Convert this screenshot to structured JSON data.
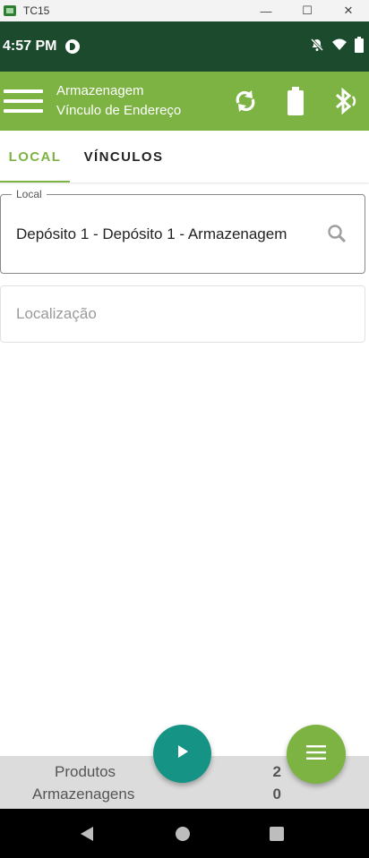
{
  "window": {
    "title": "TC15",
    "minimize_glyph": "—",
    "maximize_glyph": "☐",
    "close_glyph": "✕"
  },
  "status_bar": {
    "time": "4:57 PM",
    "icons": [
      "app-notification-icon",
      "mute-icon",
      "wifi-icon",
      "battery-icon"
    ]
  },
  "app_bar": {
    "title": "Armazenagem",
    "subtitle": "Vínculo de Endereço",
    "actions": [
      "sync-icon",
      "battery-icon",
      "bluetooth-icon"
    ],
    "color": "#7cb342"
  },
  "tabs": [
    {
      "label": "LOCAL",
      "active": true
    },
    {
      "label": "VÍNCULOS",
      "active": false
    }
  ],
  "form": {
    "local": {
      "label": "Local",
      "value": "Depósito 1 - Depósito 1 - Armazenagem"
    },
    "localizacao": {
      "placeholder": "Localização",
      "value": ""
    }
  },
  "summary": {
    "rows": [
      {
        "label": "Produtos",
        "value": "2"
      },
      {
        "label": "Armazenagens",
        "value": "0"
      }
    ]
  },
  "fabs": {
    "play": "play-icon",
    "menu": "menu-icon"
  },
  "colors": {
    "status_bar": "#1b4a2d",
    "accent": "#7cb342",
    "fab_play": "#159486"
  }
}
